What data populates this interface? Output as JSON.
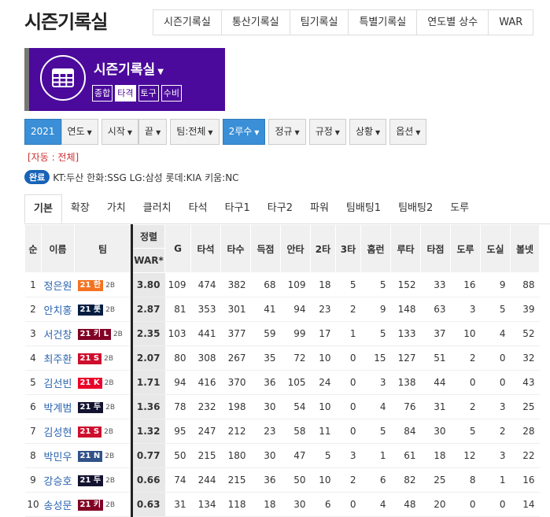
{
  "header": {
    "title": "시즌기록실"
  },
  "top_tabs": [
    "시즌기록실",
    "통산기록실",
    "팀기록실",
    "특별기록실",
    "연도별 상수",
    "WAR"
  ],
  "banner": {
    "title": "시즌기록실",
    "buttons": [
      "종합",
      "타격",
      "토구",
      "수비"
    ],
    "active": "타격"
  },
  "filters": {
    "year": "2021",
    "buttons": [
      "연도",
      "시작",
      "끝",
      "팀:전체",
      "2루수",
      "정규",
      "규정",
      "상황",
      "옵션"
    ]
  },
  "auto_text": "[자동 : 전체]",
  "legend": {
    "badge": "완료",
    "text": "KT:두산 한화:SSG LG:삼성 롯데:KIA 키움:NC"
  },
  "subtabs": [
    "기본",
    "확장",
    "가치",
    "클러치",
    "타석",
    "타구1",
    "타구2",
    "파워",
    "팀배팅1",
    "팀배팅2",
    "도루"
  ],
  "table": {
    "sort_label": "정렬",
    "headers": [
      "순",
      "이름",
      "팀",
      "WAR*",
      "G",
      "타석",
      "타수",
      "득점",
      "안타",
      "2타",
      "3타",
      "홈런",
      "루타",
      "타점",
      "도루",
      "도실",
      "볼넷"
    ],
    "rows": [
      {
        "rank": "1",
        "name": "정은원",
        "team": "21 한",
        "team_color": "#f37321",
        "pos": "2B",
        "war": "3.80",
        "stats": [
          "109",
          "474",
          "382",
          "68",
          "109",
          "18",
          "5",
          "5",
          "152",
          "33",
          "16",
          "9",
          "88"
        ]
      },
      {
        "rank": "2",
        "name": "안치홍",
        "team": "21 롯",
        "team_color": "#041e42",
        "pos": "2B",
        "war": "2.87",
        "stats": [
          "81",
          "353",
          "301",
          "41",
          "94",
          "23",
          "2",
          "9",
          "148",
          "63",
          "3",
          "5",
          "39"
        ]
      },
      {
        "rank": "3",
        "name": "서건창",
        "team": "21 키 L",
        "team_color": "#820024",
        "pos": "2B",
        "war": "2.35",
        "stats": [
          "103",
          "441",
          "377",
          "59",
          "99",
          "17",
          "1",
          "5",
          "133",
          "37",
          "10",
          "4",
          "52"
        ]
      },
      {
        "rank": "4",
        "name": "최주환",
        "team": "21 S",
        "team_color": "#ce0e2d",
        "pos": "2B",
        "war": "2.07",
        "stats": [
          "80",
          "308",
          "267",
          "35",
          "72",
          "10",
          "0",
          "15",
          "127",
          "51",
          "2",
          "0",
          "32"
        ]
      },
      {
        "rank": "5",
        "name": "김선빈",
        "team": "21 K",
        "team_color": "#ea0029",
        "pos": "2B",
        "war": "1.71",
        "stats": [
          "94",
          "416",
          "370",
          "36",
          "105",
          "24",
          "0",
          "3",
          "138",
          "44",
          "0",
          "0",
          "43"
        ]
      },
      {
        "rank": "6",
        "name": "박계범",
        "team": "21 두",
        "team_color": "#131230",
        "pos": "2B",
        "war": "1.36",
        "stats": [
          "78",
          "232",
          "198",
          "30",
          "54",
          "10",
          "0",
          "4",
          "76",
          "31",
          "2",
          "3",
          "25"
        ]
      },
      {
        "rank": "7",
        "name": "김성현",
        "team": "21 S",
        "team_color": "#ce0e2d",
        "pos": "2B",
        "war": "1.32",
        "stats": [
          "95",
          "247",
          "212",
          "23",
          "58",
          "11",
          "0",
          "5",
          "84",
          "30",
          "5",
          "2",
          "28"
        ]
      },
      {
        "rank": "8",
        "name": "박민우",
        "team": "21 N",
        "team_color": "#315288",
        "pos": "2B",
        "war": "0.77",
        "stats": [
          "50",
          "215",
          "180",
          "30",
          "47",
          "5",
          "3",
          "1",
          "61",
          "18",
          "12",
          "3",
          "22"
        ]
      },
      {
        "rank": "9",
        "name": "강승호",
        "team": "21 두",
        "team_color": "#131230",
        "pos": "2B",
        "war": "0.66",
        "stats": [
          "74",
          "244",
          "215",
          "36",
          "50",
          "10",
          "2",
          "6",
          "82",
          "25",
          "8",
          "1",
          "16"
        ]
      },
      {
        "rank": "10",
        "name": "송성문",
        "team": "21 키",
        "team_color": "#820024",
        "pos": "2B",
        "war": "0.63",
        "stats": [
          "31",
          "134",
          "118",
          "18",
          "30",
          "6",
          "0",
          "4",
          "48",
          "20",
          "0",
          "0",
          "14"
        ]
      }
    ]
  }
}
